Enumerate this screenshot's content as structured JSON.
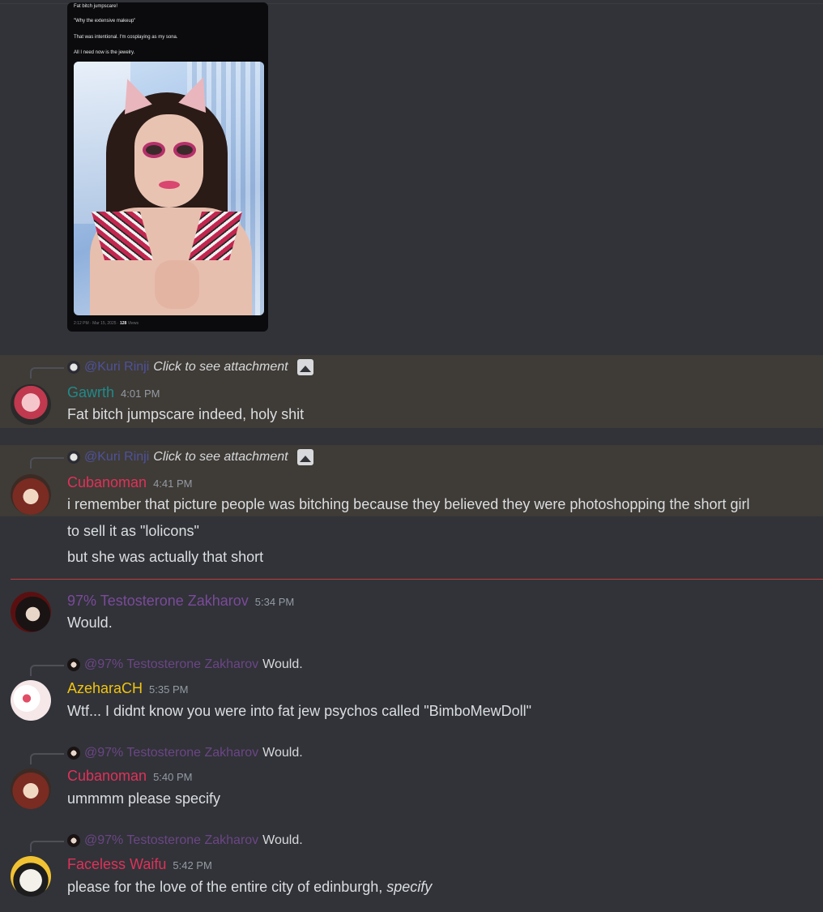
{
  "attachment": {
    "lines": [
      "Fat bitch jumpscare!",
      "\"Why the extensive makeup\"",
      "That was intentional.  I'm cosplaying as my sona.",
      "All I need now is the jewelry."
    ],
    "meta_time": "2:12 PM · Mar 15, 2025 · ",
    "meta_views_count": "128",
    "meta_views_label": " Views"
  },
  "messages": [
    {
      "reply": {
        "mention": "@Kuri Rinji",
        "snippet": "Click to see attachment"
      },
      "username": "Gawrth",
      "username_color": "#1f8b8b",
      "time": "4:01 PM",
      "lines": [
        "Fat bitch jumpscare indeed, holy shit"
      ]
    },
    {
      "reply": {
        "mention": "@Kuri Rinji",
        "snippet": "Click to see attachment"
      },
      "username": "Cubanoman",
      "username_color": "#e0315a",
      "time": "4:41 PM",
      "lines": [
        "i remember that picture people was bitching because they believed they were photoshopping the short girl",
        "to sell it as \"lolicons\"",
        "but she was actually that short"
      ]
    },
    {
      "username": "97% Testosterone Zakharov",
      "username_color": "#7b4a9a",
      "time": "5:34 PM",
      "lines": [
        "Would."
      ]
    },
    {
      "reply": {
        "mention": "@97% Testosterone Zakharov",
        "snippet": "Would."
      },
      "username": "AzeharaCH",
      "username_color": "#f1c40f",
      "time": "5:35 PM",
      "lines": [
        "Wtf... I didnt know you were into fat jew psychos called \"BimboMewDoll\""
      ]
    },
    {
      "reply": {
        "mention": "@97% Testosterone Zakharov",
        "snippet": "Would."
      },
      "username": "Cubanoman",
      "username_color": "#e0315a",
      "time": "5:40 PM",
      "lines": [
        "ummmm please specify"
      ]
    },
    {
      "reply": {
        "mention": "@97% Testosterone Zakharov",
        "snippet": "Would."
      },
      "username": "Faceless Waifu",
      "username_color": "#e0315a",
      "time": "5:42 PM",
      "lines_rich": {
        "plain": "please for the love of the entire city of edinburgh, ",
        "italic": "specify"
      }
    }
  ]
}
